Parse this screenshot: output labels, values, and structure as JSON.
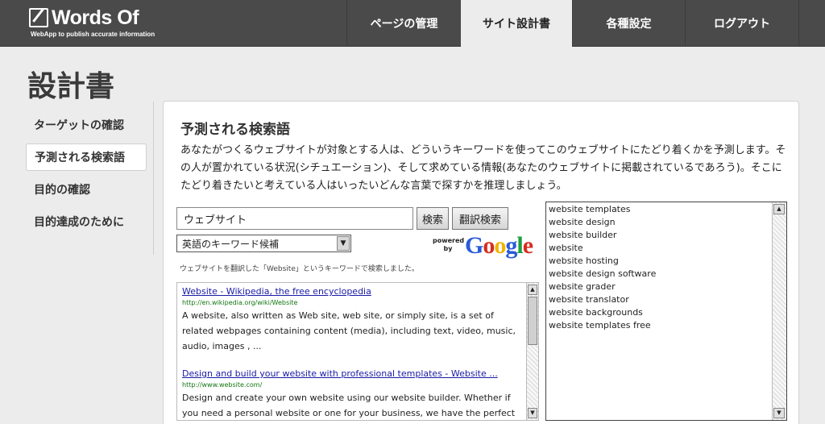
{
  "header": {
    "logo_text": "Words Of",
    "logo_tagline": "WebApp to publish accurate information",
    "nav": {
      "pages": "ページの管理",
      "spec": "サイト設計書",
      "settings": "各種設定",
      "logout": "ログアウト"
    }
  },
  "page_title": "設計書",
  "sidebar": {
    "items": [
      {
        "label": "ターゲットの確認"
      },
      {
        "label": "予測される検索語"
      },
      {
        "label": "目的の確認"
      },
      {
        "label": "目的達成のために"
      }
    ]
  },
  "main": {
    "section_title": "予測される検索語",
    "description": "あなたがつくるウェブサイトが対象とする人は、どういうキーワードを使ってこのウェブサイトにたどり着くかを予測します。その人が置かれている状況(シチュエーション)、そして求めている情報(あなたのウェブサイトに掲載されているであろう)。そこにたどり着きたいと考えている人はいったいどんな言葉で探すかを推理しましょう。",
    "search": {
      "value": "ウェブサイト",
      "search_button": "検索",
      "translate_button": "翻訳検索",
      "select_value": "英語のキーワード候補"
    },
    "google": {
      "powered_by": "powered by",
      "letters": [
        "G",
        "o",
        "o",
        "g",
        "l",
        "e"
      ],
      "colors": [
        "#2a5bd7",
        "#d62d20",
        "#f2b300",
        "#2a5bd7",
        "#1a9e3c",
        "#d62d20"
      ]
    },
    "search_note": "ウェブサイトを翻訳した「Website」というキーワードで検索しました。",
    "results": [
      {
        "title": "Website - Wikipedia, the free encyclopedia",
        "url": "http://en.wikipedia.org/wiki/Website",
        "snippet": "A website, also written as Web site, web site, or simply site, is a set of related webpages containing content (media), including text, video, music, audio, images , ..."
      },
      {
        "title": "Design and build your website with professional templates - Website ...",
        "url": "http://www.website.com/",
        "snippet": "Design and create your own website using our website builder. Whether if you need a personal website or one for your business, we have the perfect solution"
      }
    ],
    "keywords": [
      "website templates",
      "website design",
      "website builder",
      "website",
      "website hosting",
      "website design software",
      "website grader",
      "website translator",
      "website backgrounds",
      "website templates free"
    ]
  }
}
